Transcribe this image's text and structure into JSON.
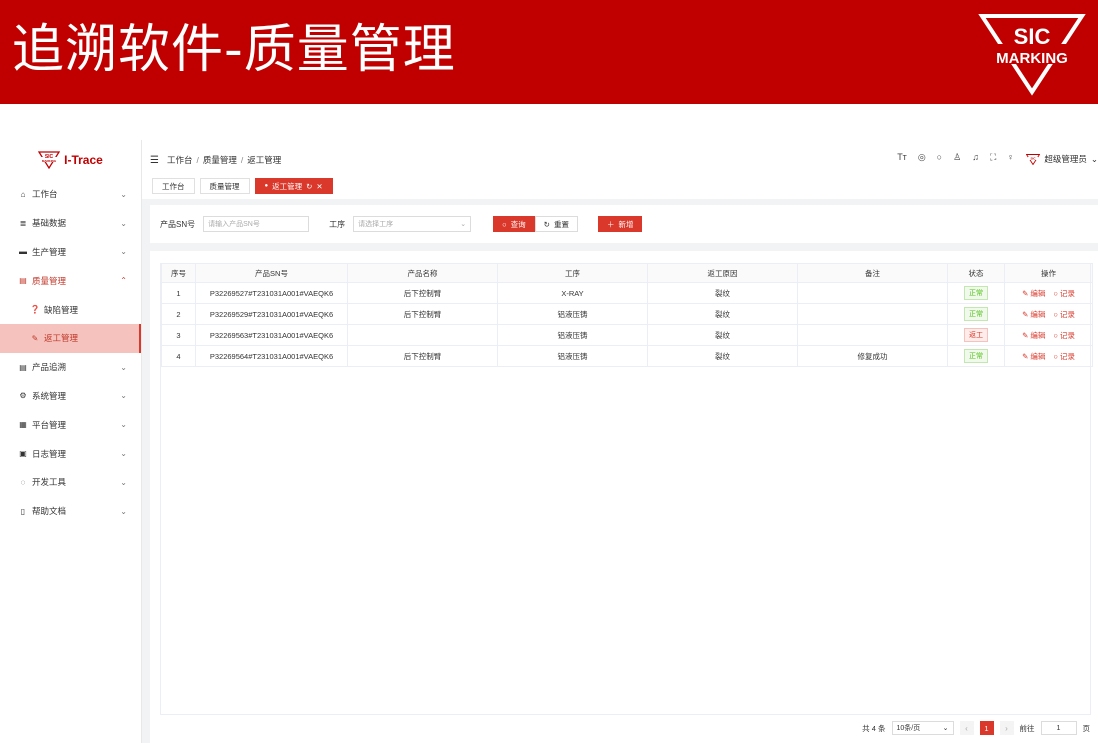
{
  "banner": {
    "title": "追溯软件-质量管理",
    "logo_top": "SIC",
    "logo_bottom": "MARKING"
  },
  "brand": {
    "name": "I-Trace",
    "logo_top": "SIC",
    "logo_bottom": "MARKING"
  },
  "sidebar": {
    "items": [
      {
        "label": "工作台",
        "icon": "home-icon"
      },
      {
        "label": "基础数据",
        "icon": "database-icon"
      },
      {
        "label": "生产管理",
        "icon": "monitor-icon"
      },
      {
        "label": "质量管理",
        "icon": "calendar-icon",
        "open": true,
        "children": [
          {
            "label": "缺陷管理",
            "icon": "question-icon"
          },
          {
            "label": "返工管理",
            "icon": "edit-icon",
            "active": true
          }
        ]
      },
      {
        "label": "产品追溯",
        "icon": "calendar-icon"
      },
      {
        "label": "系统管理",
        "icon": "gear-icon"
      },
      {
        "label": "平台管理",
        "icon": "grid-icon"
      },
      {
        "label": "日志管理",
        "icon": "log-icon"
      },
      {
        "label": "开发工具",
        "icon": "loading-icon"
      },
      {
        "label": "帮助文档",
        "icon": "book-icon"
      }
    ]
  },
  "header": {
    "breadcrumb": [
      "工作台",
      "质量管理",
      "返工管理"
    ],
    "user": "超级管理员"
  },
  "tabs": [
    {
      "label": "工作台"
    },
    {
      "label": "质量管理"
    },
    {
      "label": "返工管理",
      "active": true
    }
  ],
  "filter": {
    "sn_label": "产品SN号",
    "sn_placeholder": "请输入产品SN号",
    "process_label": "工序",
    "process_placeholder": "请选择工序",
    "query_label": "查询",
    "reset_label": "重置",
    "add_label": "新增"
  },
  "table": {
    "columns": [
      "序号",
      "产品SN号",
      "产品名称",
      "工序",
      "返工原因",
      "备注",
      "状态",
      "操作"
    ],
    "rows": [
      {
        "no": "1",
        "sn": "P32269527#T231031A001#VAEQK6",
        "name": "后下控制臂",
        "process": "X-RAY",
        "reason": "裂纹",
        "note": "",
        "status": "正常",
        "status_type": "ok"
      },
      {
        "no": "2",
        "sn": "P32269529#T231031A001#VAEQK6",
        "name": "后下控制臂",
        "process": "铝液压铸",
        "reason": "裂纹",
        "note": "",
        "status": "正常",
        "status_type": "ok"
      },
      {
        "no": "3",
        "sn": "P32269563#T231031A001#VAEQK6",
        "name": "",
        "process": "铝液压铸",
        "reason": "裂纹",
        "note": "",
        "status": "返工",
        "status_type": "bad"
      },
      {
        "no": "4",
        "sn": "P32269564#T231031A001#VAEQK6",
        "name": "后下控制臂",
        "process": "铝液压铸",
        "reason": "裂纹",
        "note": "修复成功",
        "status": "正常",
        "status_type": "ok"
      }
    ],
    "edit_label": "编辑",
    "record_label": "记录"
  },
  "pager": {
    "total": "共 4 条",
    "page_size": "10条/页",
    "current": "1",
    "goto_label": "前往",
    "goto_value": "1",
    "page_unit": "页"
  },
  "colors": {
    "banner": "#c00000",
    "accent": "#d9382b"
  }
}
